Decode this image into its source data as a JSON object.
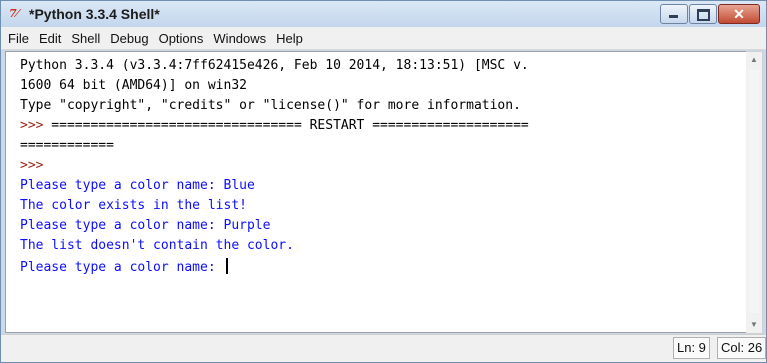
{
  "window": {
    "title": "*Python 3.3.4 Shell*",
    "icon_glyph": "7⁄",
    "icon": "python-idle-icon",
    "controls": {
      "minimize": "minimize-icon",
      "maximize": "maximize-icon",
      "close_glyph": "✕"
    }
  },
  "menubar": {
    "items": [
      "File",
      "Edit",
      "Shell",
      "Debug",
      "Options",
      "Windows",
      "Help"
    ]
  },
  "shell": {
    "lines": [
      {
        "text": "Python 3.3.4 (v3.3.4:7ff62415e426, Feb 10 2014, 18:13:51) [MSC v.",
        "kind": "info"
      },
      {
        "text": "1600 64 bit (AMD64)] on win32",
        "kind": "info"
      },
      {
        "text": "Type \"copyright\", \"credits\" or \"license()\" for more information.",
        "kind": "info"
      },
      {
        "prompt": ">>>",
        "text": " ================================ RESTART ====================",
        "kind": "restart"
      },
      {
        "text": "============",
        "kind": "info"
      },
      {
        "prompt": ">>>",
        "text": "",
        "kind": "prompt"
      },
      {
        "text": "Please type a color name: Blue",
        "kind": "output"
      },
      {
        "text": "The color exists in the list!",
        "kind": "output"
      },
      {
        "text": "Please type a color name: Purple",
        "kind": "output"
      },
      {
        "text": "The list doesn't contain the color.",
        "kind": "output"
      },
      {
        "text": "Please type a color name: ",
        "kind": "output-cursor"
      }
    ],
    "colors": {
      "output": "#0d0dff",
      "prompt": "#9b1f16",
      "text": "#000000"
    }
  },
  "status": {
    "line": "Ln: 9",
    "col": "Col: 26"
  }
}
